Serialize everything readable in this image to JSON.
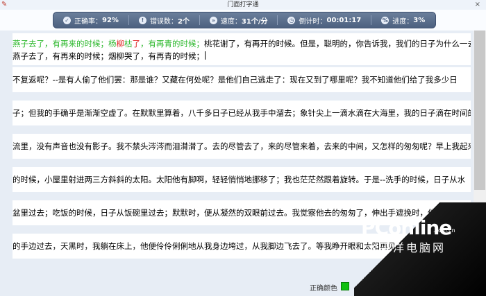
{
  "window": {
    "title": "门面打字通",
    "close_glyph": "×"
  },
  "stats": {
    "accuracy": {
      "label": "正确率：",
      "value": "92%"
    },
    "errors": {
      "label": "错误数：",
      "value": "2个"
    },
    "speed": {
      "label": "速度：",
      "value": "31个/分"
    },
    "timer": {
      "label": "倒计时：",
      "value": "00:01:17"
    },
    "progress": {
      "label": "进度：",
      "value": "3%"
    }
  },
  "reference_line": {
    "correct_part1": "燕子去了，有再来的时候；杨",
    "error_char1": "柳",
    "correct_part2": "枯",
    "error_char2": "了",
    "correct_part3": "，有再青的时候；",
    "remaining": "桃花谢了，有再开的时候。但是，聪明的，你告诉我，我们的日子为什么一去"
  },
  "typed_line": "燕子去了，有再来的时候；烟柳哭了，有再青的时候；",
  "rows": [
    "不复返呢？--是有人偷了他们罢：那是谁？又藏在何处呢？是他们自己逃走了：现在又到了哪里呢？我不知道他们给了我多少日",
    "子；但我的手确乎是渐渐空虚了。在默默里算着，八千多日子已经从我手中溜去；象针尖上一滴水滴在大海里，我的日子滴在时间的",
    "流里，没有声音也没有影子。我不禁头涔涔而泪潸潸了。去的尽管去了，来的尽管来着，去来的中间，又怎样的匆匆呢？早上我起来",
    "的时候，小屋里射进两三方斜斜的太阳。太阳他有脚啊，轻轻悄悄地挪移了；我也茫茫然跟着旋转。于是--洗手的时候，日子从水",
    "盆里过去；吃饭的时候，日子从饭碗里过去；默默时，便从凝然的双眼前过去。我觉察他去的匆匆了，伸出手遮挽时，他又从遮挽着",
    "的手边过去，天黑时，我躺在床上，他便伶伶俐俐地从我身边垮过，从我脚边飞去了。等我睁开眼和太阳再见，这算又溜走了一日。"
  ],
  "footer": {
    "color_label": "正确颜色"
  },
  "watermark": {
    "brand": "PConline",
    "domain": ".com.cn",
    "subtitle": "太平洋电脑网"
  },
  "colors": {
    "correct": "#2db82d",
    "error": "#e02020",
    "swatch": "#11c011"
  }
}
